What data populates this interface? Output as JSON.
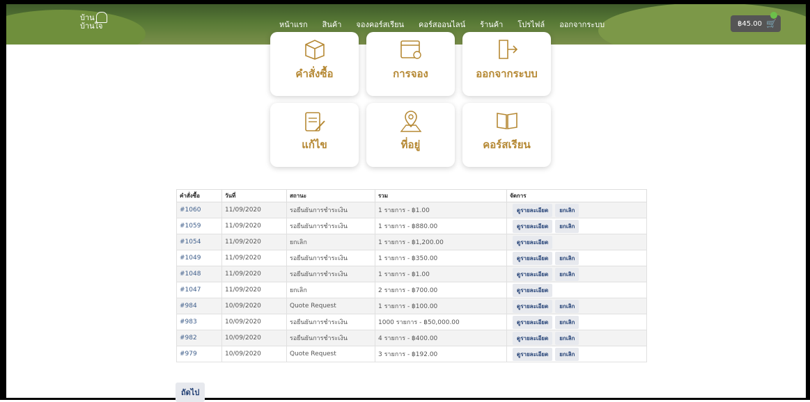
{
  "header": {
    "logo_text": "บ้าน",
    "logo_sub": "บ้านใจ",
    "nav": [
      "หน้าแรก",
      "สินค้า",
      "จองคอร์สเรียน",
      "คอร์สออนไลน์",
      "ร้านค้า",
      "โปรไฟล์",
      "ออกจากระบบ"
    ],
    "active_nav": "โปรไฟล์",
    "cart_total": "฿45.00"
  },
  "tiles": [
    {
      "label": "คำสั่งซื้อ",
      "icon": "box-icon"
    },
    {
      "label": "การจอง",
      "icon": "calendar-icon"
    },
    {
      "label": "ออกจากระบบ",
      "icon": "logout-icon"
    },
    {
      "label": "แก้ไข",
      "icon": "edit-icon"
    },
    {
      "label": "ที่อยู่",
      "icon": "map-pin-icon"
    },
    {
      "label": "คอร์สเรียน",
      "icon": "book-icon"
    }
  ],
  "table": {
    "headers": [
      "คำสั่งซื้อ",
      "วันที่",
      "สถานะ",
      "รวม",
      "จัดการ"
    ],
    "rows": [
      {
        "id": "#1060",
        "date": "11/09/2020",
        "status": "รอยืนยันการชำระเงิน",
        "total": "1 รายการ - ฿1.00",
        "actions": [
          "ดูรายละเอียด",
          "ยกเลิก"
        ]
      },
      {
        "id": "#1059",
        "date": "11/09/2020",
        "status": "รอยืนยันการชำระเงิน",
        "total": "1 รายการ - ฿880.00",
        "actions": [
          "ดูรายละเอียด",
          "ยกเลิก"
        ]
      },
      {
        "id": "#1054",
        "date": "11/09/2020",
        "status": "ยกเลิก",
        "total": "1 รายการ - ฿1,200.00",
        "actions": [
          "ดูรายละเอียด"
        ]
      },
      {
        "id": "#1049",
        "date": "11/09/2020",
        "status": "รอยืนยันการชำระเงิน",
        "total": "1 รายการ - ฿350.00",
        "actions": [
          "ดูรายละเอียด",
          "ยกเลิก"
        ]
      },
      {
        "id": "#1048",
        "date": "11/09/2020",
        "status": "รอยืนยันการชำระเงิน",
        "total": "1 รายการ - ฿1.00",
        "actions": [
          "ดูรายละเอียด",
          "ยกเลิก"
        ]
      },
      {
        "id": "#1047",
        "date": "11/09/2020",
        "status": "ยกเลิก",
        "total": "2 รายการ - ฿700.00",
        "actions": [
          "ดูรายละเอียด"
        ]
      },
      {
        "id": "#984",
        "date": "10/09/2020",
        "status": "Quote Request",
        "total": "1 รายการ - ฿100.00",
        "actions": [
          "ดูรายละเอียด",
          "ยกเลิก"
        ]
      },
      {
        "id": "#983",
        "date": "10/09/2020",
        "status": "รอยืนยันการชำระเงิน",
        "total": "1000 รายการ - ฿50,000.00",
        "actions": [
          "ดูรายละเอียด",
          "ยกเลิก"
        ]
      },
      {
        "id": "#982",
        "date": "10/09/2020",
        "status": "รอยืนยันการชำระเงิน",
        "total": "4 รายการ - ฿400.00",
        "actions": [
          "ดูรายละเอียด",
          "ยกเลิก"
        ]
      },
      {
        "id": "#979",
        "date": "10/09/2020",
        "status": "Quote Request",
        "total": "3 รายการ - ฿192.00",
        "actions": [
          "ดูรายละเอียด",
          "ยกเลิก"
        ]
      }
    ]
  },
  "pagination": {
    "next_label": "ถัดไป"
  },
  "colors": {
    "accent": "#b58833",
    "link": "#3d5d8a",
    "button_text": "#213f74"
  }
}
